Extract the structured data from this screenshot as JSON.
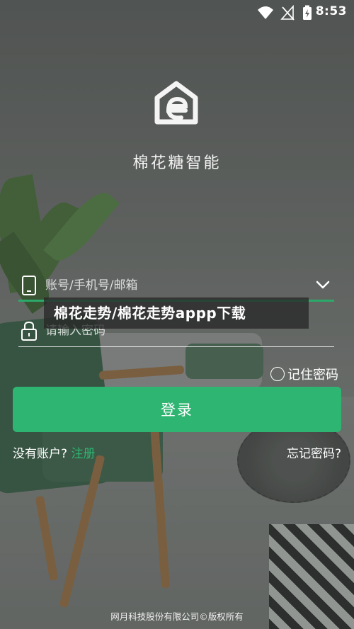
{
  "status_bar": {
    "time": "8:53",
    "icons": [
      "wifi-icon",
      "no-signal-icon",
      "battery-charging-icon"
    ]
  },
  "app": {
    "name": "棉花糖智能",
    "logo_icon": "app-logo-icon"
  },
  "form": {
    "account_placeholder": "账号/手机号/邮箱",
    "password_placeholder": "请输入密码",
    "remember_label": "记住密码",
    "login_label": "登录",
    "no_account_label": "没有账户?",
    "register_label": "注册",
    "forgot_label": "忘记密码?"
  },
  "overlay_banner": "棉花走势/棉花走势appp下载",
  "footer": {
    "copyright": "网月科技股份有限公司©版权所有"
  },
  "colors": {
    "accent": "#2fb572",
    "underline_active": "#2ca86a"
  }
}
